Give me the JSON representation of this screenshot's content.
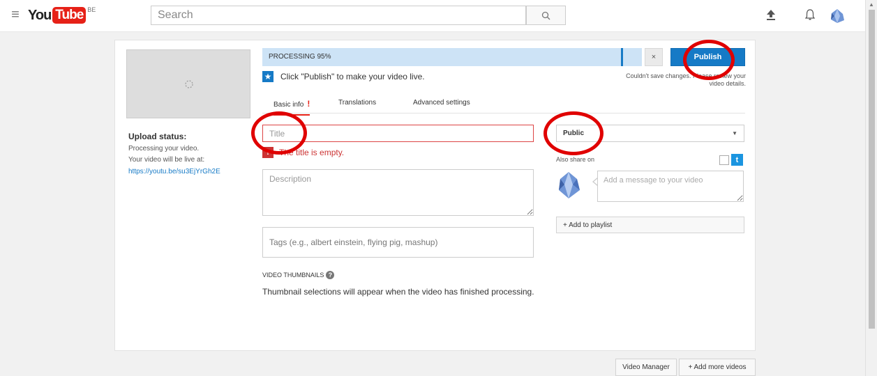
{
  "header": {
    "logo_you": "You",
    "logo_tube": "Tube",
    "logo_region": "BE",
    "search_placeholder": "Search"
  },
  "upload_panel": {
    "status_heading": "Upload status:",
    "status_text": "Processing your video.",
    "live_text": "Your video will be live at:",
    "video_link": "https://youtu.be/su3EjYrGh2E",
    "progress_label": "PROCESSING 95%",
    "progress_fraction": 0.95,
    "cancel_label": "×",
    "publish_label": "Publish",
    "save_error": "Couldn't save changes. Please review your video details.",
    "hint_text": "Click \"Publish\" to make your video live."
  },
  "tabs": [
    {
      "label": "Basic info",
      "badge": "!"
    },
    {
      "label": "Translations"
    },
    {
      "label": "Advanced settings"
    }
  ],
  "form": {
    "title_placeholder": "Title",
    "title_error_icon": "!",
    "title_error": "The title is empty.",
    "description_placeholder": "Description",
    "tags_placeholder": "Tags (e.g., albert einstein, flying pig, mashup)",
    "thumbnails_heading": "VIDEO THUMBNAILS",
    "thumbnails_help": "?",
    "thumbnails_note": "Thumbnail selections will appear when the video has finished processing."
  },
  "sidebar": {
    "privacy_value": "Public",
    "caret": "▼",
    "share_label": "Also share on",
    "twitter_glyph": "t",
    "message_placeholder": "Add a message to your video",
    "playlist_label": "+ Add to playlist"
  },
  "footer": {
    "video_manager_label": "Video Manager",
    "add_more_label": "+ Add more videos"
  },
  "colors": {
    "accent": "#167ac6",
    "error": "#e62117",
    "annotation": "#e00000",
    "progress_bg": "#cde3f6"
  }
}
